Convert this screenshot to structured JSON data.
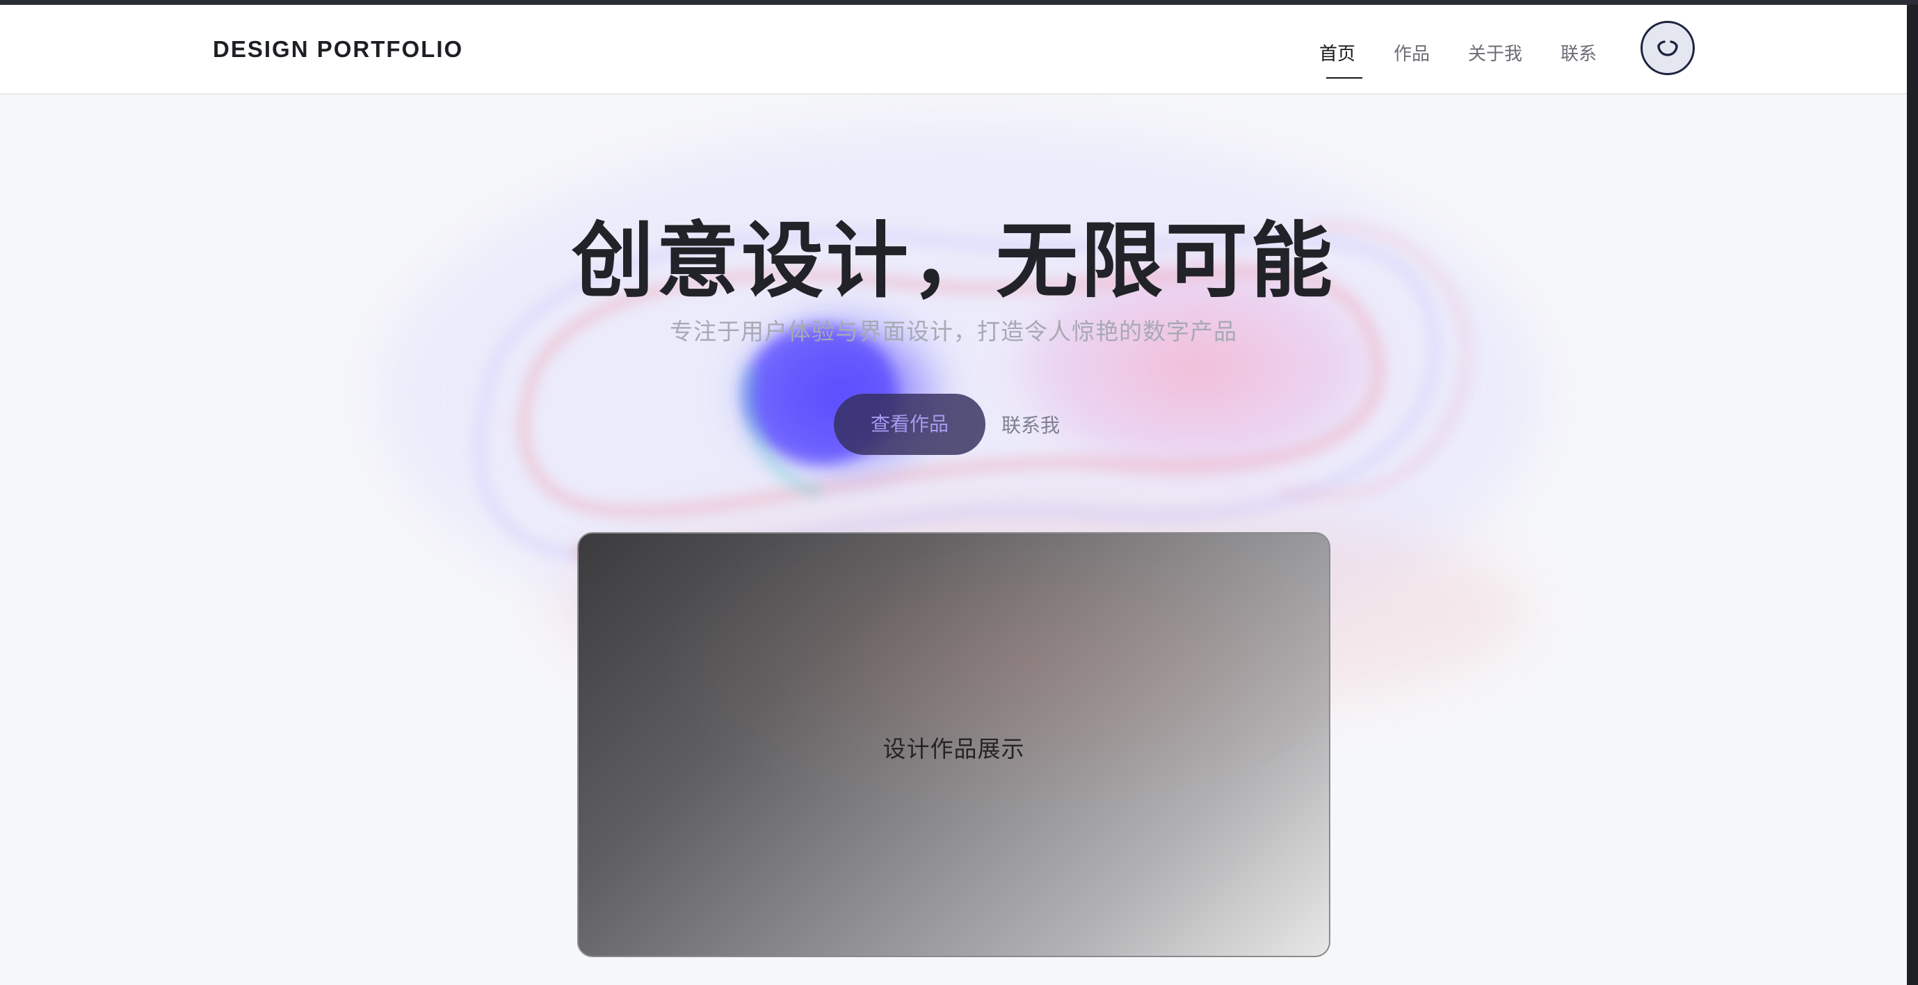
{
  "header": {
    "brand": "DESIGN PORTFOLIO",
    "nav": [
      {
        "label": "首页",
        "active": true
      },
      {
        "label": "作品",
        "active": false
      },
      {
        "label": "关于我",
        "active": false
      },
      {
        "label": "联系",
        "active": false
      }
    ],
    "theme_toggle_icon": "moon-icon"
  },
  "hero": {
    "title": "创意设计，无限可能",
    "subtitle": "专注于用户体验与界面设计，打造令人惊艳的数字产品",
    "primary_button": "查看作品",
    "secondary_button": "联系我"
  },
  "showcase": {
    "label": "设计作品展示"
  },
  "colors": {
    "page_bg": "#f6f7f9",
    "text_dark": "#222328",
    "primary_button_bg": "#342e5c",
    "blob_blue": "#6a5cff",
    "blob_pink": "#f07aa8"
  }
}
